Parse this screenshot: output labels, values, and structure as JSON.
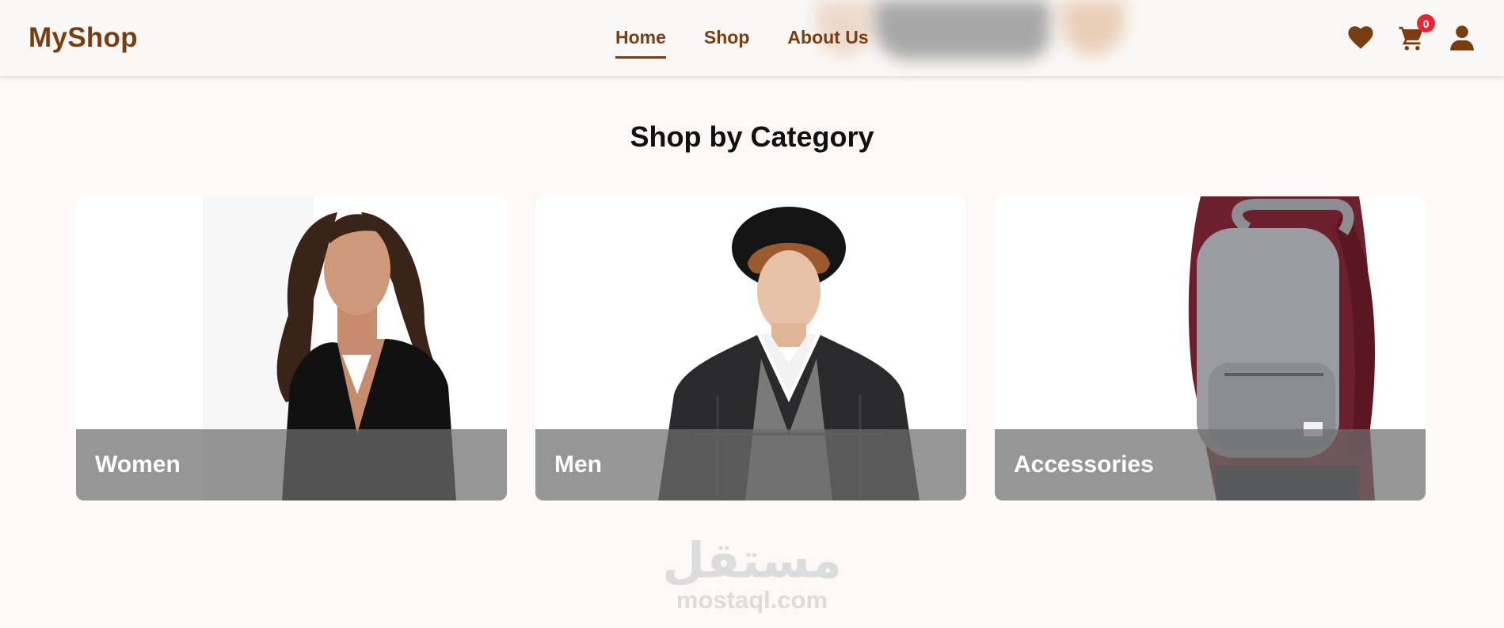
{
  "brand": {
    "name": "MyShop"
  },
  "nav": [
    {
      "label": "Home",
      "active": true
    },
    {
      "label": "Shop",
      "active": false
    },
    {
      "label": "About Us",
      "active": false
    }
  ],
  "header_icons": {
    "wishlist": "heart-icon",
    "cart": "cart-icon",
    "account": "user-icon",
    "cart_count": "0"
  },
  "section": {
    "title": "Shop by Category"
  },
  "categories": [
    {
      "label": "Women"
    },
    {
      "label": "Men"
    },
    {
      "label": "Accessories"
    }
  ],
  "watermark": {
    "arabic": "مستقل",
    "latin": "mostaql.com"
  },
  "colors": {
    "brand": "#7a3d0f",
    "badge": "#e8262d",
    "background": "#fdf7f6"
  }
}
